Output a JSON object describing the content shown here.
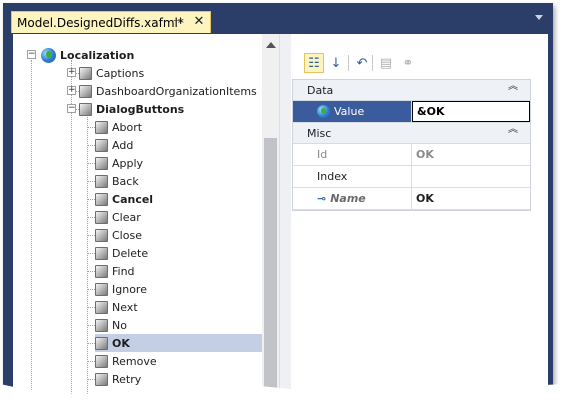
{
  "window": {
    "tab_title": "Model.DesignedDiffs.xafml*",
    "pin_icon": "pin-icon",
    "close_icon": "close-icon"
  },
  "tree": {
    "root": {
      "label": "Localization",
      "icon": "globe-icon",
      "expanded": true
    },
    "groups": [
      {
        "label": "Captions",
        "expanded": false
      },
      {
        "label": "DashboardOrganizationItems",
        "expanded": false
      },
      {
        "label": "DialogButtons",
        "expanded": true
      }
    ],
    "items": [
      {
        "label": "Abort",
        "bold": false,
        "selected": false
      },
      {
        "label": "Add",
        "bold": false,
        "selected": false
      },
      {
        "label": "Apply",
        "bold": false,
        "selected": false
      },
      {
        "label": "Back",
        "bold": false,
        "selected": false
      },
      {
        "label": "Cancel",
        "bold": true,
        "selected": false
      },
      {
        "label": "Clear",
        "bold": false,
        "selected": false
      },
      {
        "label": "Close",
        "bold": false,
        "selected": false
      },
      {
        "label": "Delete",
        "bold": false,
        "selected": false
      },
      {
        "label": "Find",
        "bold": false,
        "selected": false
      },
      {
        "label": "Ignore",
        "bold": false,
        "selected": false
      },
      {
        "label": "Next",
        "bold": false,
        "selected": false
      },
      {
        "label": "No",
        "bold": false,
        "selected": false
      },
      {
        "label": "OK",
        "bold": true,
        "selected": true
      },
      {
        "label": "Remove",
        "bold": false,
        "selected": false
      },
      {
        "label": "Retry",
        "bold": false,
        "selected": false
      }
    ]
  },
  "toolbar": {
    "buttons": [
      {
        "name": "categorized-icon",
        "glyph": "☷",
        "active": true,
        "disabled": false
      },
      {
        "name": "sort-alphabetical-icon",
        "glyph": "↓",
        "active": false,
        "disabled": false
      },
      {
        "name": "undo-icon",
        "glyph": "↶",
        "active": false,
        "disabled": false
      },
      {
        "name": "properties-icon",
        "glyph": "▤",
        "active": false,
        "disabled": true
      },
      {
        "name": "link-icon",
        "glyph": "⚭",
        "active": false,
        "disabled": true
      }
    ]
  },
  "property_grid": {
    "categories": [
      {
        "label": "Data",
        "properties": [
          {
            "name": "Value",
            "value": "&OK",
            "icon": "globe-icon",
            "selected": true,
            "disabled": false,
            "italic": false
          }
        ]
      },
      {
        "label": "Misc",
        "properties": [
          {
            "name": "Id",
            "value": "OK",
            "icon": "",
            "selected": false,
            "disabled": true,
            "italic": false
          },
          {
            "name": "Index",
            "value": "",
            "icon": "",
            "selected": false,
            "disabled": false,
            "italic": false
          },
          {
            "name": "Name",
            "value": "OK",
            "icon": "key-icon",
            "selected": false,
            "disabled": false,
            "italic": true
          }
        ]
      }
    ]
  },
  "colors": {
    "frame": "#2b3e69",
    "tab_active": "#fdf4bf",
    "selection": "#c4cfe6",
    "grid_selection": "#3a5c9c"
  }
}
